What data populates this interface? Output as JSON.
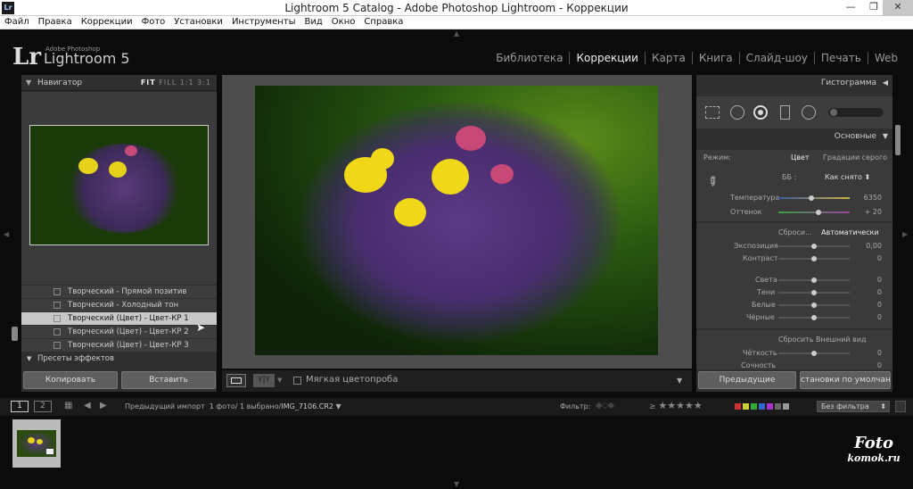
{
  "window": {
    "title": "Lightroom 5 Catalog - Adobe Photoshop Lightroom - Коррекции",
    "app_icon": "Lr"
  },
  "menu": [
    "Файл",
    "Правка",
    "Коррекции",
    "Фото",
    "Установки",
    "Инструменты",
    "Вид",
    "Окно",
    "Справка"
  ],
  "identity": {
    "lr": "Lr",
    "sub1": "Adobe Photoshop",
    "sub2": "Lightroom 5"
  },
  "modules": [
    "Библиотека",
    "Коррекции",
    "Карта",
    "Книга",
    "Слайд-шоу",
    "Печать",
    "Web"
  ],
  "active_module": "Коррекции",
  "navigator": {
    "title": "Навигатор",
    "fit": "FIT",
    "fill": "FILL",
    "r11": "1:1",
    "r31": "3:1"
  },
  "presets": [
    {
      "label": "Творческий - Прямой позитив",
      "selected": false
    },
    {
      "label": "Творческий - Холодный тон",
      "selected": false
    },
    {
      "label": "Творческий (Цвет) - Цвет-КР 1",
      "selected": true
    },
    {
      "label": "Творческий (Цвет) - Цвет-КР 2",
      "selected": false
    },
    {
      "label": "Творческий (Цвет) - Цвет-КР 3",
      "selected": false
    }
  ],
  "presets_group": "Пресеты эффектов",
  "left_buttons": {
    "copy": "Копировать",
    "paste": "Вставить"
  },
  "toolbar": {
    "softproof": "Мягкая цветопроба",
    "yy": "Y|Y"
  },
  "right": {
    "histogram": "Гистограмма",
    "basic": "Основные",
    "mode_label": "Режим:",
    "mode_color": "Цвет",
    "mode_gray": "Градации серого",
    "wb_label": "ББ :",
    "wb_value": "Как снято",
    "temp": {
      "label": "Температура",
      "value": "6350"
    },
    "tint": {
      "label": "Оттенок",
      "value": "+ 20"
    },
    "tone_label": "Сброси...",
    "auto": "Автоматически",
    "exposure": {
      "label": "Экспозиция",
      "value": "0,00"
    },
    "contrast": {
      "label": "Контраст",
      "value": "0"
    },
    "highlights": {
      "label": "Света",
      "value": "0"
    },
    "shadows": {
      "label": "Тени",
      "value": "0"
    },
    "whites": {
      "label": "Белые",
      "value": "0"
    },
    "blacks": {
      "label": "Чёрные",
      "value": "0"
    },
    "presence": "Сбросить Внешний вид",
    "clarity": {
      "label": "Чёткость",
      "value": "0"
    },
    "vibrance": {
      "label": "Сочность",
      "value": "0"
    },
    "prev_button": "Предыдущие",
    "default_button": "становки по умолчанию..."
  },
  "filmbar": {
    "p1": "1",
    "p2": "2",
    "source": "Предыдущий импорт",
    "count": "1 фото/",
    "selected": "1 выбрано/",
    "file": "IMG_7106.CR2",
    "filter": "Фильтр:",
    "filter_value": "Без фильтра"
  },
  "watermark": {
    "line1": "Foto",
    "line2": "komok.ru"
  }
}
